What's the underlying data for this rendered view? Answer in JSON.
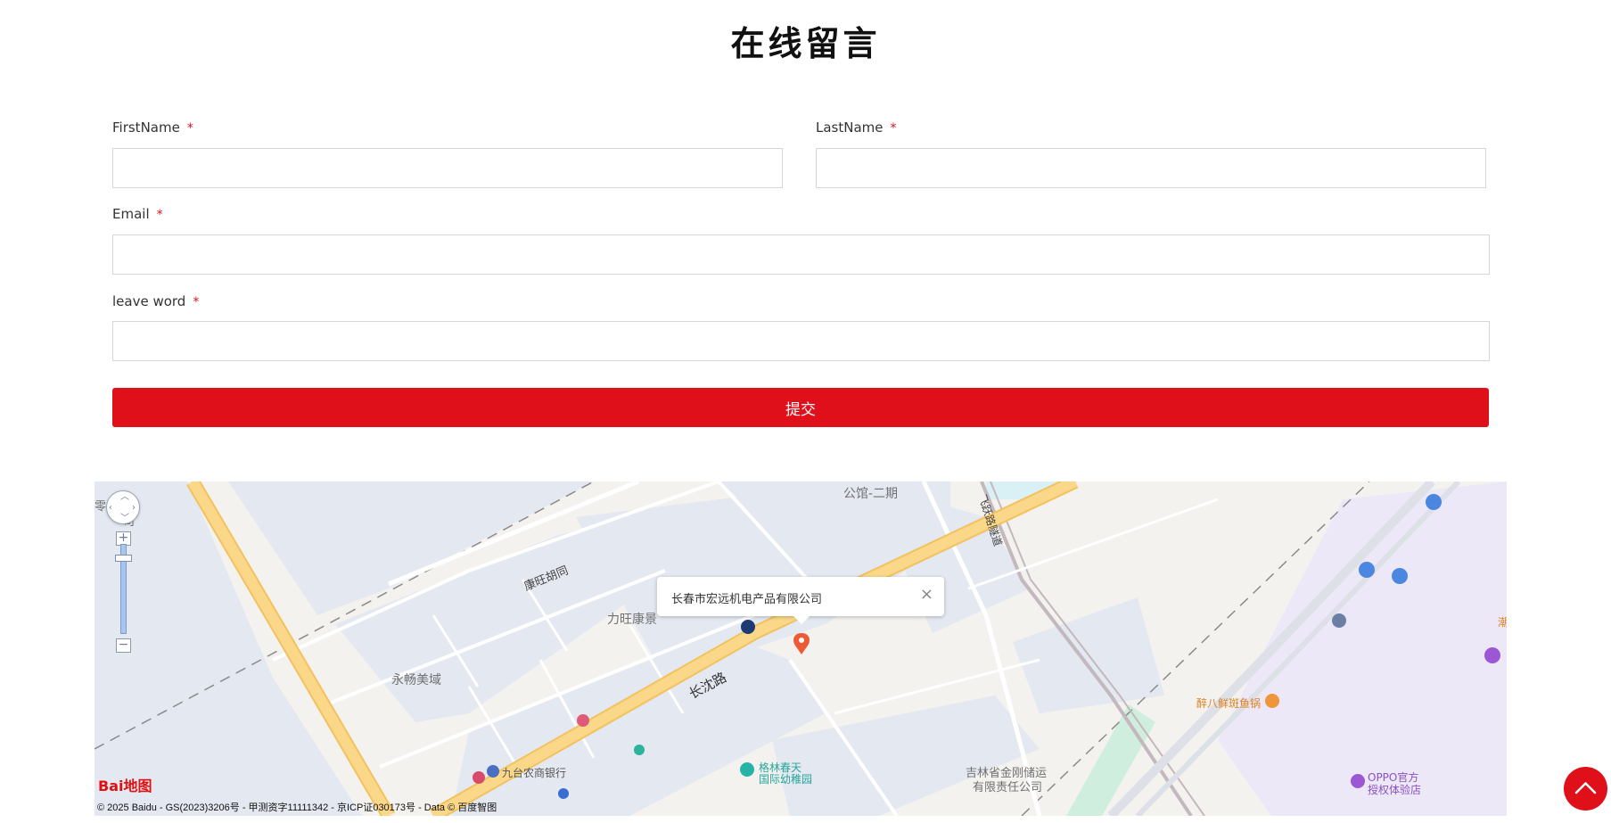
{
  "page": {
    "title": "在线留言"
  },
  "form": {
    "first_name": {
      "label": "FirstName",
      "required_mark": "*",
      "value": "",
      "placeholder": ""
    },
    "last_name": {
      "label": "LastName",
      "required_mark": "*",
      "value": "",
      "placeholder": ""
    },
    "email": {
      "label": "Email",
      "required_mark": "*",
      "value": "",
      "placeholder": ""
    },
    "leave_word": {
      "label": "leave word",
      "required_mark": "*",
      "value": "",
      "placeholder": ""
    },
    "submit_label": "提交"
  },
  "map": {
    "popup_text": "长春市宏远机电产品有限公司",
    "popup_close": "×",
    "labels": {
      "kangwang_hutong": "康旺胡同",
      "liwang_kangjing": "力旺康景",
      "yonghan_meiyu": "永畅美域",
      "changshen_road": "长沈路",
      "gongguan_phase2": "公馆-二期",
      "feiyue_tunnel": "飞跃路隧道",
      "jiutai_bank": "九台农商银行",
      "kindergarten_line1": "格林春天",
      "kindergarten_line2": "国际幼稚园",
      "jingang_line1": "吉林省金刚储运",
      "jingang_line2": "有限责任公司",
      "fish_restaurant": "醉八鲜斑鱼锅",
      "oppo_line1": "OPPO官方",
      "oppo_line2": "授权体验店",
      "topleft_fragment1": "零",
      "topleft_fragment2": "司",
      "right_edge_fragment": "潮"
    },
    "zoom_in": "+",
    "zoom_out": "−",
    "logo_text": "Bai地图",
    "copyright": "© 2025 Baidu - GS(2023)3206号 - 甲测资字11111342 - 京ICP证030173号 - Data © 百度智图"
  },
  "colors": {
    "accent": "#e0101a",
    "map_background": "#f3f2ef",
    "map_block": "#e3e8f1",
    "main_road": "#fbd889",
    "purple_zone": "#ece8f8",
    "green_zone": "#cfeedd"
  },
  "icons": {
    "back_to_top": "chevron-up-icon",
    "popup_close": "close-icon",
    "map_marker": "location-pin-icon"
  }
}
